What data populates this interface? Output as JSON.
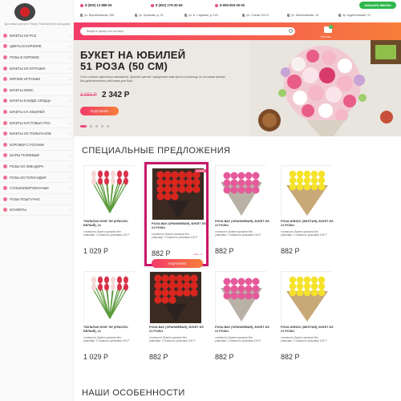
{
  "brand": {
    "tagline": "Доставка цветов в Твери. Работаем без выходных"
  },
  "menu": [
    {
      "label": "БУКЕТЫ ИЗ РОЗ",
      "has_sub": true
    },
    {
      "label": "ЦВЕТЫ В КОРЗИНЕ",
      "has_sub": true
    },
    {
      "label": "РОЗЫ В КОРОБКЕ",
      "has_sub": true
    },
    {
      "label": "БУКЕТЫ ИЗ ИГРУШЕК",
      "has_sub": true
    },
    {
      "label": "МЯГКИЕ ИГРУШКИ",
      "has_sub": true
    },
    {
      "label": "БУКЕТЫ МИКС",
      "has_sub": false
    },
    {
      "label": "БУКЕТЫ В ВИДЕ СЕРДЦА",
      "has_sub": true
    },
    {
      "label": "БУКЕТЫ НА ЮБИЛЕЙ",
      "has_sub": true
    },
    {
      "label": "БУКЕТЫ КУСТОВЫХ РОЗ",
      "has_sub": true
    },
    {
      "label": "БУКЕТЫ ИЗ ТЮЛЬПАНОВ",
      "has_sub": true
    },
    {
      "label": "КОРОБКИ С РОЗАМИ",
      "has_sub": false
    },
    {
      "label": "ШАРЫ ГЕЛИЕВЫЕ",
      "has_sub": true
    },
    {
      "label": "РОЗЫ ИЗ ЭКВАДОРА",
      "has_sub": true
    },
    {
      "label": "РОЗЫ ИЗ ГОЛЛАНДИИ",
      "has_sub": true
    },
    {
      "label": "СТАБИЛИЗИРОВАННЫЕ",
      "has_sub": true
    },
    {
      "label": "РОЗЫ ПОШТУЧНО",
      "has_sub": false
    },
    {
      "label": "КОНФЕТЫ",
      "has_sub": true
    }
  ],
  "topbar": {
    "phones": [
      "8 (900) 12-888-05",
      "8 (952) 279-30-66",
      "8-908-993-00-00"
    ],
    "callback": "ЗАКАЗАТЬ ЗВОНОК",
    "addresses": [
      "ул. Воробьевская, 265",
      "ул. Хромова, д. 24",
      "ул. Б. Садовая, д. 103",
      "ул. Стачки 123-Л",
      "ул. Малиновская, 10",
      "пр. Будённовский, 57"
    ]
  },
  "search": {
    "placeholder": "Введите фразу или артикул"
  },
  "cart": {
    "count": "0",
    "label": "ПУСТАЯ"
  },
  "hero": {
    "title_line1": "БУКЕТ НА ЮБИЛЕЙ",
    "title_line2": "51 РОЗА (50 СМ)",
    "description": "Сеть готовых цветочных магазинов \"Долина цветов\" предлагает вам цветы в розницу, по оптовым ценам! Мы действительно работаем для Вас!",
    "old_price": "3 050 Р",
    "new_price": "2 342 Р",
    "button": "ПОДРОБНЕЕ",
    "slides": 5,
    "active_slide": 0
  },
  "sections": {
    "special": "СПЕЦИАЛЬНЫЕ ПРЕДЛОЖЕНИЯ",
    "features": "НАШИ ОСОБЕННОСТИ"
  },
  "products": [
    {
      "name": "ТЮЛЬПАН КУНГ ФУ (КРАСНО-БЕЛЫЙ), 21",
      "desc": "стоимость букета указана без упаковки. Стоимость упаковки 100 Р",
      "price": "1 029 Р",
      "kind": "tulips",
      "highlight": false
    },
    {
      "name": "РОЗА ВАУ (ОРАНЖЕВАЯ), БУКЕТ ИЗ 21 РОЗЫ",
      "desc": "стоимость букета указана без упаковки. Стоимость упаковки 100 Р",
      "price": "882 Р",
      "weight": "0.5кг шт",
      "button": "ПОДРОБНЕЕ",
      "badge": "АКЦИЯ",
      "kind": "red",
      "highlight": true
    },
    {
      "name": "РОЗА ВАУ (ОРАНЖЕВАЯ), БУКЕТ ИЗ 21 РОЗЫ",
      "desc": "стоимость букета указана без упаковки. Стоимость упаковки 100 Р",
      "price": "882 Р",
      "kind": "pink",
      "highlight": false
    },
    {
      "name": "РОЗА ИЛИОС (ЖЕЛТАЯ), БУКЕТ ИЗ 21 РОЗЫ",
      "desc": "стоимость букета указана без упаковки. Стоимость упаковки 100 Р",
      "price": "882 Р",
      "kind": "yellow",
      "highlight": false
    },
    {
      "name": "ТЮЛЬПАН КУНГ ФУ (КРАСНО-БЕЛЫЙ), 21",
      "desc": "стоимость букета указана без упаковки. Стоимость упаковки 100 Р",
      "price": "1 029 Р",
      "kind": "tulips",
      "highlight": false
    },
    {
      "name": "РОЗА ВАУ (ОРАНЖЕВАЯ), БУКЕТ ИЗ 21 РОЗЫ",
      "desc": "стоимость букета указана без упаковки. Стоимость упаковки 100 Р",
      "price": "882 Р",
      "kind": "red",
      "highlight": false
    },
    {
      "name": "РОЗА ВАУ (ОРАНЖЕВАЯ), БУКЕТ ИЗ 21 РОЗЫ",
      "desc": "стоимость букета указана без упаковки. Стоимость упаковки 100 Р",
      "price": "882 Р",
      "kind": "pink",
      "highlight": false
    },
    {
      "name": "РОЗА ИЛИОС (ЖЕЛТАЯ), БУКЕТ ИЗ 21 РОЗЫ",
      "desc": "стоимость букета указана без упаковки. Стоимость упаковки 100 Р",
      "price": "882 Р",
      "kind": "yellow",
      "highlight": false
    }
  ],
  "colors": {
    "accent_start": "#f43b6a",
    "accent_end": "#f77e3a",
    "callback_green": "#2db84b",
    "highlight_border": "#c9176a"
  }
}
